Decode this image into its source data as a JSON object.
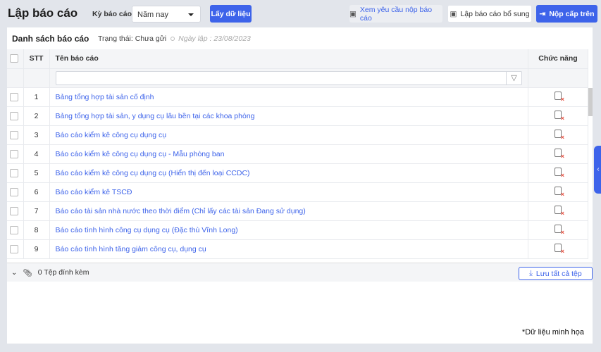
{
  "header": {
    "title": "Lập báo cáo",
    "period_label": "Kỳ báo cáo",
    "period_value": "Năm nay",
    "get_data": "Lấy dữ liệu",
    "view_requests": "Xem yêu cầu nộp báo cáo",
    "add_report": "Lập báo cáo bổ sung",
    "submit": "Nộp cấp trên"
  },
  "panel": {
    "title": "Danh sách báo cáo",
    "status": "Trạng thái: Chưa gửi",
    "date": "Ngày lập : 23/08/2023"
  },
  "table": {
    "columns": [
      "STT",
      "Tên báo cáo",
      "Chức năng"
    ],
    "filter_value": "",
    "rows": [
      {
        "stt": "1",
        "name": "Bảng tổng hợp tài sản cố định"
      },
      {
        "stt": "2",
        "name": "Bảng tổng hợp tài sản, y dụng cụ lâu bền tại các khoa phòng"
      },
      {
        "stt": "3",
        "name": "Báo cáo kiểm kê công cụ dụng cụ"
      },
      {
        "stt": "4",
        "name": "Báo cáo kiểm kê công cụ dụng cụ - Mẫu phòng ban"
      },
      {
        "stt": "5",
        "name": "Báo cáo kiểm kê công cụ dụng cụ (Hiển thị đến loại CCDC)"
      },
      {
        "stt": "6",
        "name": "Báo cáo kiểm kê TSCĐ"
      },
      {
        "stt": "7",
        "name": "Báo cáo tài sản nhà nước theo thời điểm (Chỉ lấy các tài sản Đang sử dụng)"
      },
      {
        "stt": "8",
        "name": "Báo cáo tình hình công cụ dụng cụ (Đặc thù Vĩnh Long)"
      },
      {
        "stt": "9",
        "name": "Báo cáo tình hình tăng giảm công cụ, dụng cụ"
      }
    ]
  },
  "footer": {
    "attachments": "0 Tệp đính kèm",
    "save_all": "Lưu tất cả tệp"
  },
  "note": "*Dữ liệu minh họa"
}
